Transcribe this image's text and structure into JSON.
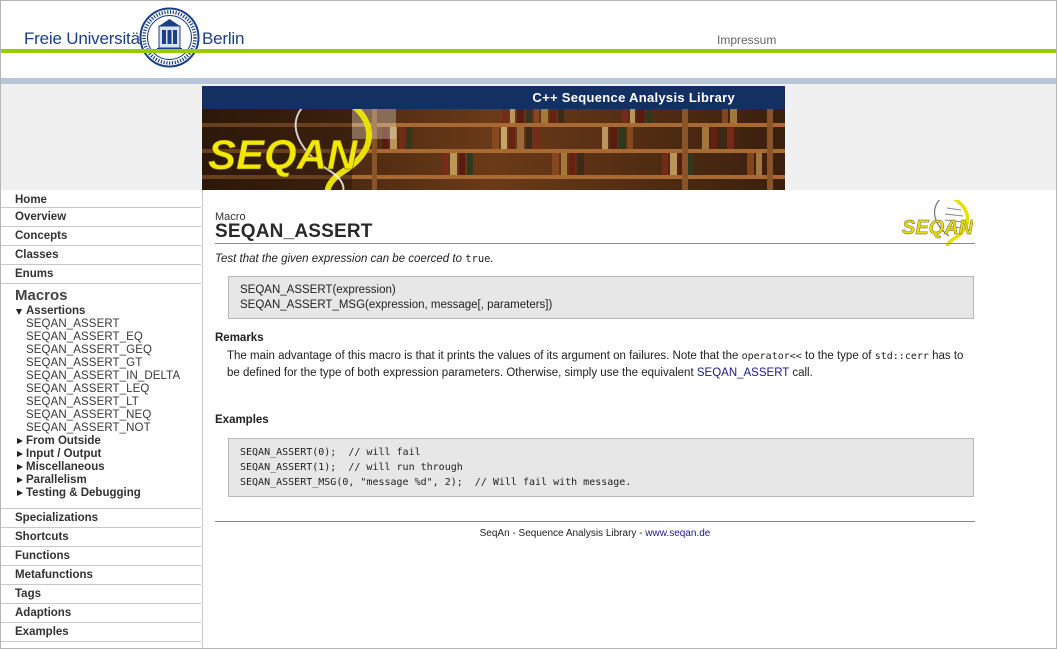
{
  "header": {
    "org_left": "Freie Universität",
    "org_right": "Berlin",
    "impressum": "Impressum",
    "colors": {
      "green": "#99cc00",
      "blue": "#b8c6da",
      "navy": "#143063"
    }
  },
  "banner": {
    "title": "C++ Sequence Analysis Library",
    "logo_text": "SEQAN"
  },
  "sidebar": {
    "top_items": [
      "Home",
      "Overview",
      "Concepts",
      "Classes",
      "Enums"
    ],
    "current_section": "Macros",
    "open_group": "Assertions",
    "assert_items": [
      "SEQAN_ASSERT",
      "SEQAN_ASSERT_EQ",
      "SEQAN_ASSERT_GEQ",
      "SEQAN_ASSERT_GT",
      "SEQAN_ASSERT_IN_DELTA",
      "SEQAN_ASSERT_LEQ",
      "SEQAN_ASSERT_LT",
      "SEQAN_ASSERT_NEQ",
      "SEQAN_ASSERT_NOT"
    ],
    "closed_groups": [
      "From Outside",
      "Input / Output",
      "Miscellaneous",
      "Parallelism",
      "Testing & Debugging"
    ],
    "bottom_items": [
      "Specializations",
      "Shortcuts",
      "Functions",
      "Metafunctions",
      "Tags",
      "Adaptions",
      "Examples"
    ]
  },
  "page": {
    "kind": "Macro",
    "title": "SEQAN_ASSERT",
    "small_logo_text": "SEQAN",
    "summary_prefix": "Test that the given expression can be coerced to",
    "summary_code": "true",
    "summary_suffix": ".",
    "signatures": [
      "SEQAN_ASSERT(expression)",
      "SEQAN_ASSERT_MSG(expression, message[, parameters])"
    ],
    "remarks_heading": "Remarks",
    "remarks": {
      "p1": "The main advantage of this macro is that it prints the values of its argument on failures. Note that the",
      "code1": "operator<<",
      "p2": "to the type of",
      "code2": "std::cerr",
      "p3": "has to be defined for the type of both expression parameters. Otherwise, simply use the equivalent",
      "link": "SEQAN_ASSERT",
      "p4": "call."
    },
    "examples_heading": "Examples",
    "examples": [
      "SEQAN_ASSERT(0);  // will fail",
      "SEQAN_ASSERT(1);  // will run through",
      "SEQAN_ASSERT_MSG(0, \"message %d\", 2);  // Will fail with message."
    ],
    "footer_text": "SeqAn - Sequence Analysis Library -",
    "footer_link": "www.seqan.de"
  }
}
